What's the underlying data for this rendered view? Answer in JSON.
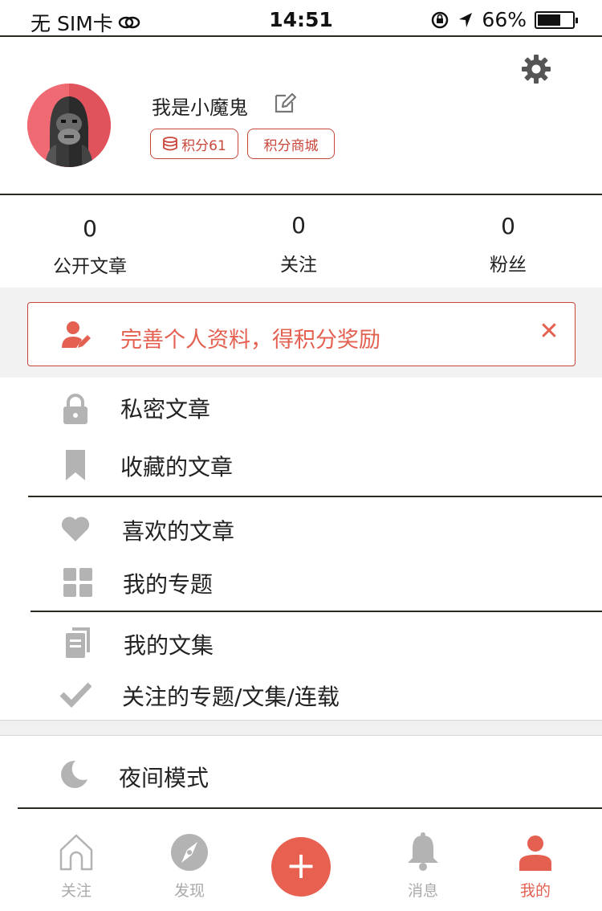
{
  "status": {
    "carrier": "无 SIM卡",
    "time": "14:51",
    "battery_text": "66%",
    "battery_level": 0.66
  },
  "profile": {
    "username": "我是小魔鬼",
    "score_label": "积分61",
    "mall_label": "积分商城"
  },
  "stats": [
    {
      "value": "0",
      "label": "公开文章"
    },
    {
      "value": "0",
      "label": "关注"
    },
    {
      "value": "0",
      "label": "粉丝"
    }
  ],
  "banner": {
    "text": "完善个人资料，得积分奖励",
    "close": "✕"
  },
  "menu": [
    {
      "label": "私密文章",
      "icon": "lock-icon"
    },
    {
      "label": "收藏的文章",
      "icon": "bookmark-icon"
    },
    {
      "label": "喜欢的文章",
      "icon": "heart-icon"
    },
    {
      "label": "我的专题",
      "icon": "grid-icon"
    },
    {
      "label": "我的文集",
      "icon": "notebook-icon"
    },
    {
      "label": "关注的专题/文集/连载",
      "icon": "check-icon"
    },
    {
      "label": "夜间模式",
      "icon": "moon-icon"
    }
  ],
  "tabs": [
    {
      "label": "关注",
      "icon": "home-icon"
    },
    {
      "label": "发现",
      "icon": "compass-icon"
    },
    {
      "label": "+",
      "icon": "plus-icon"
    },
    {
      "label": "消息",
      "icon": "bell-icon"
    },
    {
      "label": "我的",
      "icon": "person-icon"
    }
  ],
  "colors": {
    "accent": "#e46050",
    "accent_border": "#c9463a",
    "icon_gray": "#b3b3b3",
    "avatar_bg": "#e85c66"
  }
}
